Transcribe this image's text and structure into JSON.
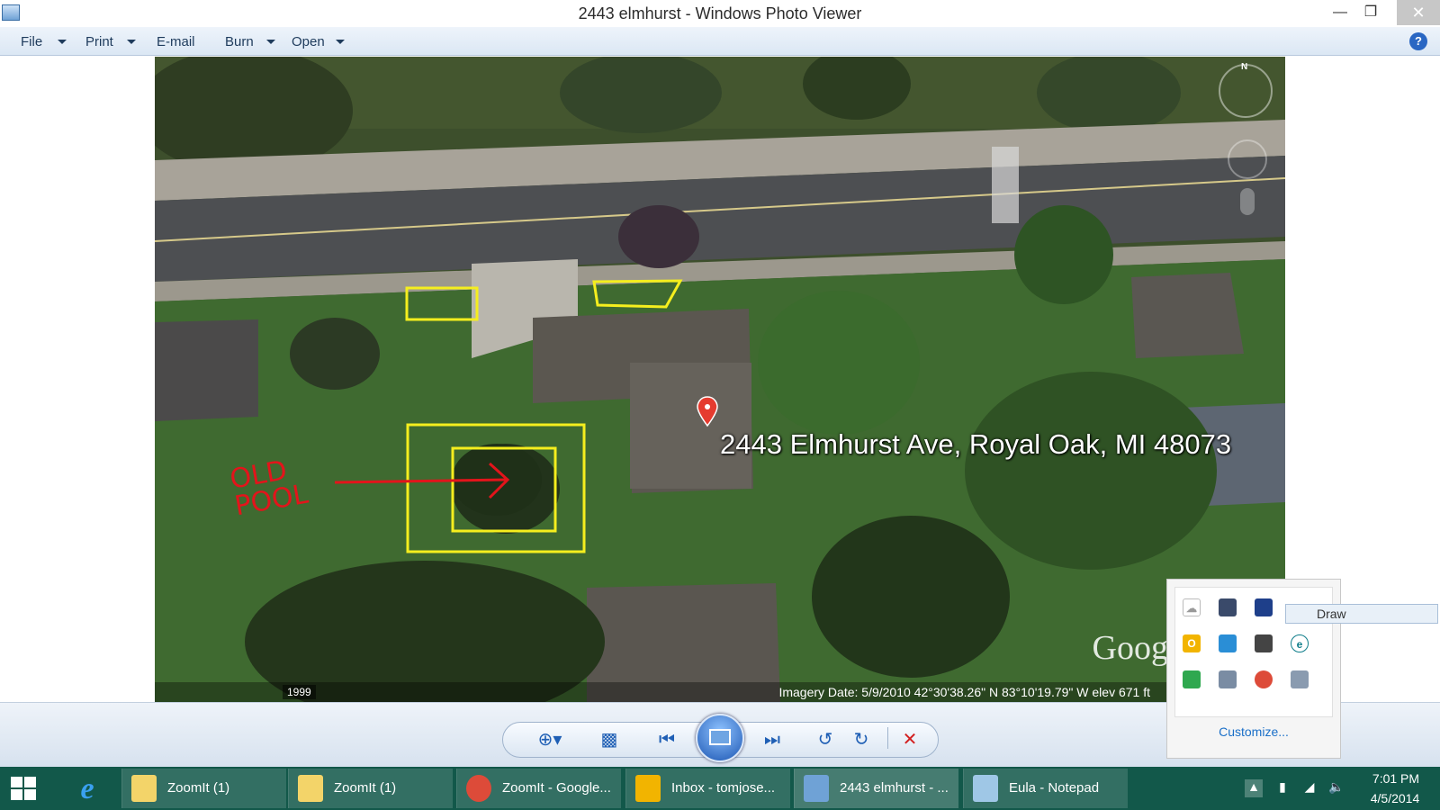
{
  "window": {
    "title": "2443 elmhurst - Windows Photo Viewer"
  },
  "menu": {
    "file": "File",
    "print": "Print",
    "email": "E-mail",
    "burn": "Burn",
    "open": "Open"
  },
  "photo": {
    "address": "2443 Elmhurst Ave, Royal Oak, MI 48073",
    "annotation_text": "OLD POOL",
    "imagery_info": "Imagery Date: 5/9/2010    42°30'38.26\" N   83°10'19.79\" W  elev   671 ft",
    "year": "1999",
    "compass": "N",
    "logo": "Goog",
    "colors": {
      "highlight": "#f5ee1e",
      "annotation": "#e3141b",
      "pin": "#e53b2f"
    }
  },
  "controls": {
    "zoom": "zoom-icon",
    "actual_size": "fit-window-icon",
    "previous": "previous-icon",
    "slideshow": "slideshow-icon",
    "next": "next-icon",
    "rotate_ccw": "rotate-counterclockwise-icon",
    "rotate_cw": "rotate-clockwise-icon",
    "delete": "delete-icon"
  },
  "tray": {
    "customize": "Customize...",
    "tooltip": "Draw"
  },
  "taskbar": {
    "tasks": [
      {
        "label": "ZoomIt (1)"
      },
      {
        "label": "ZoomIt (1)"
      },
      {
        "label": "ZoomIt - Google..."
      },
      {
        "label": "Inbox - tomjose..."
      },
      {
        "label": "2443 elmhurst - ..."
      },
      {
        "label": "Eula - Notepad"
      }
    ],
    "clock_time": "7:01 PM",
    "clock_date": "4/5/2014",
    "color": "#12584a"
  }
}
